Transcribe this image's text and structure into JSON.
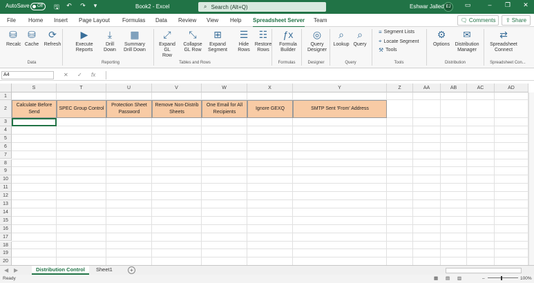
{
  "titlebar": {
    "autosave": "AutoSave",
    "toggle": "Off",
    "doc_title": "Book2 - Excel",
    "search": "Search (Alt+Q)",
    "user": "Eshwar Jalleda",
    "initials": "EJ"
  },
  "tabs": [
    "File",
    "Home",
    "Insert",
    "Page Layout",
    "Formulas",
    "Data",
    "Review",
    "View",
    "Help",
    "Spreadsheet Server",
    "Team"
  ],
  "actions": {
    "comments": "Comments",
    "share": "Share"
  },
  "ribbon": {
    "buttons": [
      {
        "id": "recalc",
        "line1": "Recalc",
        "line2": "",
        "icon": "database-icon",
        "glyph": "⛁"
      },
      {
        "id": "cache",
        "line1": "Cache",
        "line2": "",
        "icon": "cache-icon",
        "glyph": "⛁"
      },
      {
        "id": "refresh",
        "line1": "Refresh",
        "line2": "",
        "icon": "refresh-icon",
        "glyph": "⟳"
      },
      {
        "id": "execute-reports",
        "line1": "Execute",
        "line2": "Reports",
        "icon": "execute-icon",
        "glyph": "▶"
      },
      {
        "id": "drill-down",
        "line1": "Drill",
        "line2": "Down",
        "icon": "drill-icon",
        "glyph": "⤓"
      },
      {
        "id": "summary-drill-down",
        "line1": "Summary",
        "line2": "Drill Down",
        "icon": "summary-icon",
        "glyph": "▦"
      },
      {
        "id": "expand-gl-row",
        "line1": "Expand GL",
        "line2": "Row",
        "icon": "expand-icon",
        "glyph": "⤢"
      },
      {
        "id": "collapse-gl-row",
        "line1": "Collapse",
        "line2": "GL Row",
        "icon": "collapse-icon",
        "glyph": "⤡"
      },
      {
        "id": "expand-segment",
        "line1": "Expand",
        "line2": "Segment",
        "icon": "segment-icon",
        "glyph": "⊞"
      },
      {
        "id": "hide-rows",
        "line1": "Hide",
        "line2": "Rows",
        "icon": "hide-rows-icon",
        "glyph": "☰"
      },
      {
        "id": "restore-rows",
        "line1": "Restore",
        "line2": "Rows",
        "icon": "restore-rows-icon",
        "glyph": "☷"
      },
      {
        "id": "formula-builder",
        "line1": "Formula",
        "line2": "Builder",
        "icon": "formula-icon",
        "glyph": "ƒx"
      },
      {
        "id": "query-designer",
        "line1": "Query",
        "line2": "Designer",
        "icon": "query-designer-icon",
        "glyph": "◎"
      },
      {
        "id": "lookup",
        "line1": "Lookup",
        "line2": "",
        "icon": "lookup-icon",
        "glyph": "⌕"
      },
      {
        "id": "query",
        "line1": "Query",
        "line2": "",
        "icon": "query-icon",
        "glyph": "⌕"
      },
      {
        "id": "options",
        "line1": "Options",
        "line2": "",
        "icon": "gear-icon",
        "glyph": "⚙"
      },
      {
        "id": "distribution-manager",
        "line1": "Distribution",
        "line2": "Manager",
        "icon": "distribution-icon",
        "glyph": "✉"
      },
      {
        "id": "spreadsheet-connect",
        "line1": "Spreadsheet",
        "line2": "Connect",
        "icon": "connect-icon",
        "glyph": "⇄"
      }
    ],
    "small": [
      {
        "id": "segment-lists",
        "label": "Segment Lists",
        "icon": "list-icon",
        "glyph": "≡"
      },
      {
        "id": "locate-segment",
        "label": "Locate Segment",
        "icon": "locate-icon",
        "glyph": "⌖"
      },
      {
        "id": "tools",
        "label": "Tools",
        "icon": "tools-icon",
        "glyph": "⚒"
      }
    ],
    "groups": [
      "Data",
      "Reporting",
      "Tables and Rows",
      "Formulas",
      "Designer",
      "Query",
      "Tools",
      "Distribution",
      "Spreadsheet Con..."
    ]
  },
  "formula_bar": {
    "name_box": "A4",
    "cancel": "✕",
    "enter": "✓",
    "fx": "fx",
    "value": ""
  },
  "columns": [
    "S",
    "T",
    "U",
    "V",
    "W",
    "X",
    "Y",
    "Z",
    "AA",
    "AB",
    "AC",
    "AD"
  ],
  "rows": [
    "1",
    "2",
    "3",
    "4",
    "5",
    "6",
    "7",
    "8",
    "9",
    "10",
    "11",
    "12",
    "13",
    "14",
    "15",
    "16",
    "17",
    "18",
    "19",
    "20"
  ],
  "headers": [
    "Calculate Before Send",
    "SPEC Group Control",
    "Protection Sheet Password",
    "Remove Non-Distrib Sheets",
    "One Email for All Recipients",
    "Ignore GEXQ",
    "SMTP Sent 'From' Address"
  ],
  "sheets": [
    "Distribution Control",
    "Sheet1"
  ],
  "status": {
    "ready": "Ready",
    "zoom": "100%"
  }
}
